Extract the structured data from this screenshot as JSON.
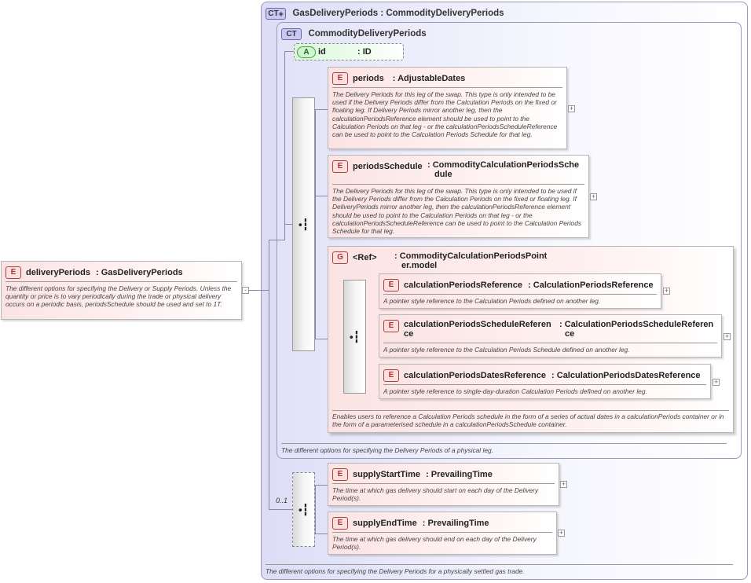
{
  "root": {
    "badge": "E",
    "name": "deliveryPeriods",
    "type": ": GasDeliveryPeriods",
    "doc": "The different options for specifying the Delivery or Supply Periods. Unless the quantity or price is to vary periodically during the trade or physical delivery occurs on a periodic basis, periodsSchedule should be used and set to 1T.",
    "collapse": "-"
  },
  "gasDeliveryPeriods": {
    "badge": "CT",
    "title": "GasDeliveryPeriods : CommodityDeliveryPeriods",
    "doc": "The different options for specifying the Delivery Periods for a physically settled gas trade."
  },
  "commodityDeliveryPeriods": {
    "badge": "CT",
    "title": "CommodityDeliveryPeriods",
    "doc": "The different options for specifying the Delivery Periods of a physical leg."
  },
  "attribute": {
    "badge": "A",
    "name": "id",
    "type": ": ID"
  },
  "periods": {
    "badge": "E",
    "name": "periods",
    "type": ": AdjustableDates",
    "doc": "The Delivery Periods for this leg of the swap. This type is only intended to be used if the Delivery Periods differ from the Calculation Periods on the fixed or floating leg. If Delivery Periods mirror another leg, then the calculationPeriodsReference element should be used to point to the Calculation Periods on that leg - or the calculationPeriodsScheduleReference can be used to point to the Calculation Periods Schedule for that leg.",
    "expand": "+"
  },
  "periodsSchedule": {
    "badge": "E",
    "name": "periodsSchedule",
    "type1": ": CommodityCalculationPeriodsSche",
    "type2": "dule",
    "doc": "The Delivery Periods for this leg of the swap. This type is only intended to be used if the Delivery Periods differ from the Calculation Periods on the fixed or floating leg. If DeliveryPeriods mirror another leg, then the calculationPeriodsReference element should be used to point to the Calculation Periods on that leg - or the calculationPeriodsScheduleReference can be used to point to the Calculation Periods Schedule for that leg.",
    "expand": "+"
  },
  "group": {
    "badge": "G",
    "name": "<Ref>",
    "type1": ": CommodityCalculationPeriodsPoint",
    "type2": "er.model",
    "doc": "Enables users to reference a Calculation Periods schedule in the form of a series of actual dates in a calculationPeriods container or in the form of a parameterised schedule in a calculationPeriodsSchedule container."
  },
  "calculationPeriodsReference": {
    "badge": "E",
    "name": "calculationPeriodsReference",
    "type": ": CalculationPeriodsReference",
    "doc": "A pointer style reference to the Calculation Periods defined on another leg.",
    "expand": "+"
  },
  "calculationPeriodsScheduleReference": {
    "badge": "E",
    "name1": "calculationPeriodsScheduleReferen",
    "name2": "ce",
    "type1": ": CalculationPeriodsScheduleReferen",
    "type2": "ce",
    "doc": "A pointer style reference to the Calculation Periods Schedule defined on another leg.",
    "expand": "+"
  },
  "calculationPeriodsDatesReference": {
    "badge": "E",
    "name": "calculationPeriodsDatesReference",
    "type": ": CalculationPeriodsDatesReference",
    "doc": "A pointer style reference to single-day-duration Calculation Periods defined on another leg.",
    "expand": "+"
  },
  "supplyStartTime": {
    "badge": "E",
    "name": "supplyStartTime",
    "type": ": PrevailingTime",
    "doc": "The time at which gas delivery should start on each day of the Delivery Period(s).",
    "expand": "+"
  },
  "supplyEndTime": {
    "badge": "E",
    "name": "supplyEndTime",
    "type": ": PrevailingTime",
    "doc": "The time at which gas delivery should end on each day of the Delivery Period(s).",
    "expand": "+"
  },
  "occurrence": "0..1",
  "icons": {
    "sequence": "sequence-icon",
    "ct": "complex-type-icon"
  },
  "colors": {
    "element": "#fbe3e3",
    "complexType": "#dcdcf6",
    "attribute": "#cff5cf"
  }
}
